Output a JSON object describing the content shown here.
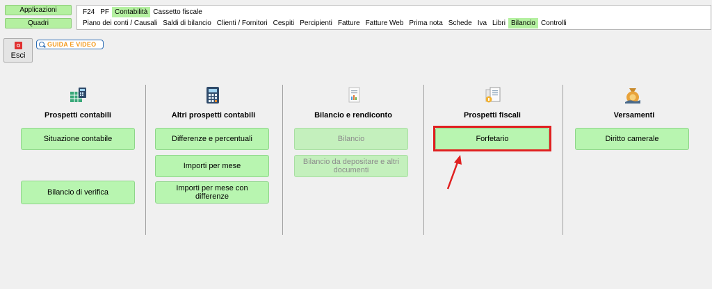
{
  "nav": {
    "app_buttons": [
      "Applicazioni",
      "Quadri"
    ],
    "row1": [
      "F24",
      "PF",
      "Contabilità",
      "Cassetto fiscale"
    ],
    "row2": [
      "Piano dei conti / Causali",
      "Saldi di bilancio",
      "Clienti / Fornitori",
      "Cespiti",
      "Percipienti",
      "Fatture",
      "Fatture Web",
      "Prima nota",
      "Schede",
      "Iva",
      "Libri",
      "Bilancio",
      "Controlli"
    ],
    "active_row1": "Contabilità",
    "active_row2": "Bilancio"
  },
  "toolbar": {
    "exit_label": "Esci",
    "guide_label": "GUIDA E VIDEO"
  },
  "columns": [
    {
      "icon": "spreadsheet-calculator-icon",
      "title": "Prospetti contabili",
      "buttons": [
        {
          "label": "Situazione contabile",
          "disabled": false
        },
        {
          "label": "Bilancio di verifica",
          "disabled": false
        }
      ]
    },
    {
      "icon": "calculator-icon",
      "title": "Altri prospetti contabili",
      "buttons": [
        {
          "label": "Differenze e percentuali",
          "disabled": false
        },
        {
          "label": "Importi per mese",
          "disabled": false
        },
        {
          "label": "Importi per mese con differenze",
          "disabled": false
        }
      ]
    },
    {
      "icon": "report-document-icon",
      "title": "Bilancio e rendiconto",
      "buttons": [
        {
          "label": "Bilancio",
          "disabled": true
        },
        {
          "label": "Bilancio da depositare e altri documenti",
          "disabled": true
        }
      ]
    },
    {
      "icon": "tax-documents-icon",
      "title": "Prospetti fiscali",
      "buttons": [
        {
          "label": "Forfetario",
          "disabled": false
        }
      ]
    },
    {
      "icon": "money-bag-icon",
      "title": "Versamenti",
      "buttons": [
        {
          "label": "Diritto camerale",
          "disabled": false
        }
      ]
    }
  ],
  "colors": {
    "active_tab": "#b4f0a0",
    "button_fill": "#b8f5b0",
    "highlight": "#e02020"
  }
}
